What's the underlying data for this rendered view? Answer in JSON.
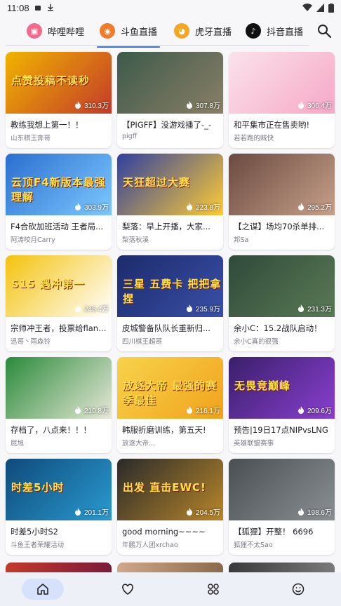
{
  "status": {
    "time": "11:08"
  },
  "tabs": [
    {
      "label": "哔哩哔哩",
      "logo_color": "#f26b8a",
      "logo_glyph": "▣"
    },
    {
      "label": "斗鱼直播",
      "logo_color": "#f3792b",
      "logo_glyph": "◉"
    },
    {
      "label": "虎牙直播",
      "logo_color": "#f5a623",
      "logo_glyph": "◕"
    },
    {
      "label": "抖音直播",
      "logo_color": "#111111",
      "logo_glyph": "♪"
    }
  ],
  "active_tab": 1,
  "cards": [
    {
      "title": "教练我想上第一！！",
      "streamer": "山东棋王奔哥",
      "viewers": "310.3万",
      "art_text": "点赞投稿不读秒",
      "colors": [
        "#f0b400",
        "#c43a2a"
      ]
    },
    {
      "title": "【PIGFF】没游戏播了-_-",
      "streamer": "pigff",
      "viewers": "307.8万",
      "art_text": "",
      "colors": [
        "#3d5a4a",
        "#8a7f66"
      ]
    },
    {
      "title": "和平集市正在售卖哟!",
      "streamer": "若若跑的贼快",
      "viewers": "306.4万",
      "art_text": "",
      "colors": [
        "#fbe2ec",
        "#f6a8c6"
      ]
    },
    {
      "title": "F4合砍加班活动 王者局...",
      "streamer": "阿涛咬月Carry",
      "viewers": "303.9万",
      "art_text": "云顶F4新版本最强理解",
      "colors": [
        "#2a6fd0",
        "#7ec8ff"
      ]
    },
    {
      "title": "梨落：早上开播，大家...",
      "streamer": "梨落秋溪",
      "viewers": "223.8万",
      "art_text": "天狂超过大赛",
      "colors": [
        "#2f3fa0",
        "#ffcc33"
      ]
    },
    {
      "title": "【之谋】场均70杀单排...",
      "streamer": "邦Sa",
      "viewers": "295.2万",
      "art_text": "",
      "colors": [
        "#6a4a40",
        "#c7a08a"
      ]
    },
    {
      "title": "宗师冲王者，投票给flancy",
      "streamer": "迅哥丶雨森铃",
      "viewers": "246.4万",
      "art_text": "S15 遇冲第一",
      "colors": [
        "#f4c20d",
        "#ffffff"
      ]
    },
    {
      "title": "皮城警备队队长重新归...",
      "streamer": "四川棋王超哥",
      "viewers": "235.9万",
      "art_text": "三星 五费卡 把把拿捏",
      "colors": [
        "#1c2b6b",
        "#3a4fa8"
      ]
    },
    {
      "title": "余小C：15.2战队启动！",
      "streamer": "余小C真的很强",
      "viewers": "231.3万",
      "art_text": "",
      "colors": [
        "#2f4a3a",
        "#5a7a55"
      ]
    },
    {
      "title": "存档了，八点来！！！",
      "streamer": "屁旭",
      "viewers": "210.8万",
      "art_text": "",
      "colors": [
        "#2a8a3a",
        "#e8e8d8"
      ]
    },
    {
      "title": "韩服折磨训练，第五天!",
      "streamer": "放逐大帝...",
      "viewers": "216.1万",
      "art_text": "放逐大帝 最强的赛季最佳",
      "colors": [
        "#f7d34a",
        "#f2a21c"
      ]
    },
    {
      "title": "预告|19日17点NIPvsLNG",
      "streamer": "英雄联盟赛事",
      "viewers": "209.6万",
      "art_text": "无畏竞巅峰",
      "colors": [
        "#3a1f6b",
        "#8a3fd0"
      ]
    },
    {
      "title": "时差5小时S2",
      "streamer": "斗鱼王者荣耀活动",
      "viewers": "201.1万",
      "art_text": "时差5小时",
      "colors": [
        "#0f4a7a",
        "#2a9ad0"
      ]
    },
    {
      "title": "good morning~~~~",
      "streamer": "年鹏万人团xrchao",
      "viewers": "204.5万",
      "art_text": "出发 直击EWC!",
      "colors": [
        "#2a2a2a",
        "#b8862a"
      ]
    },
    {
      "title": "【狐狸】开整！ 6696",
      "streamer": "狐狸不太Sao",
      "viewers": "198.6万",
      "art_text": "",
      "colors": [
        "#4a4f52",
        "#8a9094"
      ]
    }
  ],
  "bottom_nav": [
    {
      "name": "home-icon",
      "active": true
    },
    {
      "name": "heart-icon",
      "active": false
    },
    {
      "name": "grid-icon",
      "active": false
    },
    {
      "name": "smile-icon",
      "active": false
    }
  ]
}
